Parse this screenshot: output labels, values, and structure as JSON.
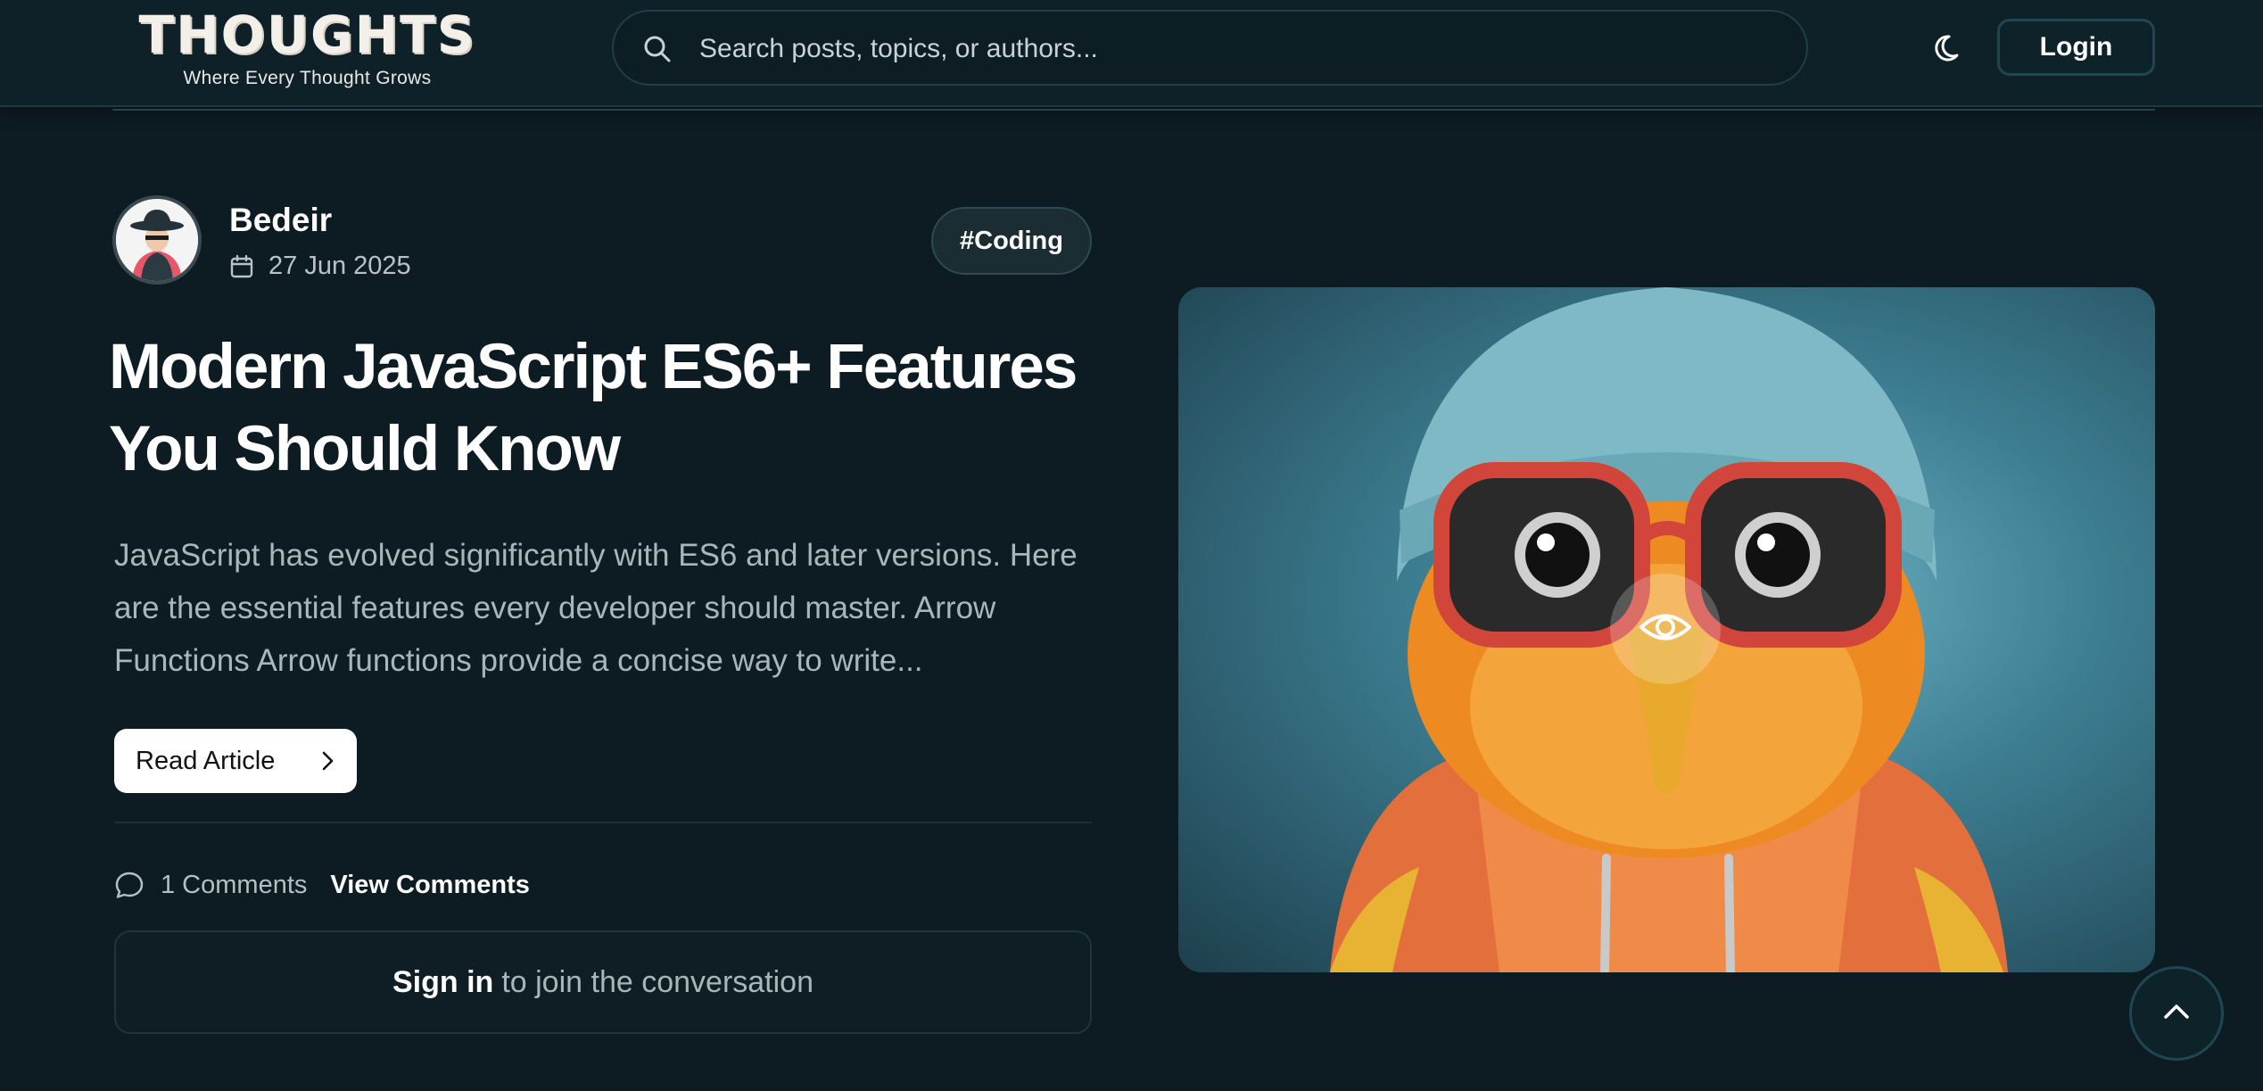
{
  "header": {
    "logo_text": "THOUGHTS",
    "tagline": "Where Every Thought Grows",
    "search_placeholder": "Search posts, topics, or authors...",
    "theme_icon": "moon-icon",
    "login_label": "Login"
  },
  "post": {
    "author": "Bedeir",
    "date": "27 Jun 2025",
    "tag": "#Coding",
    "title": "Modern JavaScript ES6+ Features You Should Know",
    "excerpt": "JavaScript has evolved significantly with ES6 and later versions. Here are the essential features every developer should master. Arrow Functions Arrow functions provide a concise way to write...",
    "read_label": "Read Article",
    "comment_count": "1 Comments",
    "view_comments_label": "View Comments",
    "signin_link": "Sign in",
    "signin_rest": "to join the conversation"
  },
  "colors": {
    "background": "#0d1c22",
    "header": "#0f2128",
    "accent_border": "#1e4752",
    "muted_text": "#a9b6bb"
  },
  "icons": [
    "search-icon",
    "moon-icon",
    "calendar-icon",
    "chevron-right-icon",
    "comment-icon",
    "eye-icon",
    "chevron-up-icon"
  ]
}
